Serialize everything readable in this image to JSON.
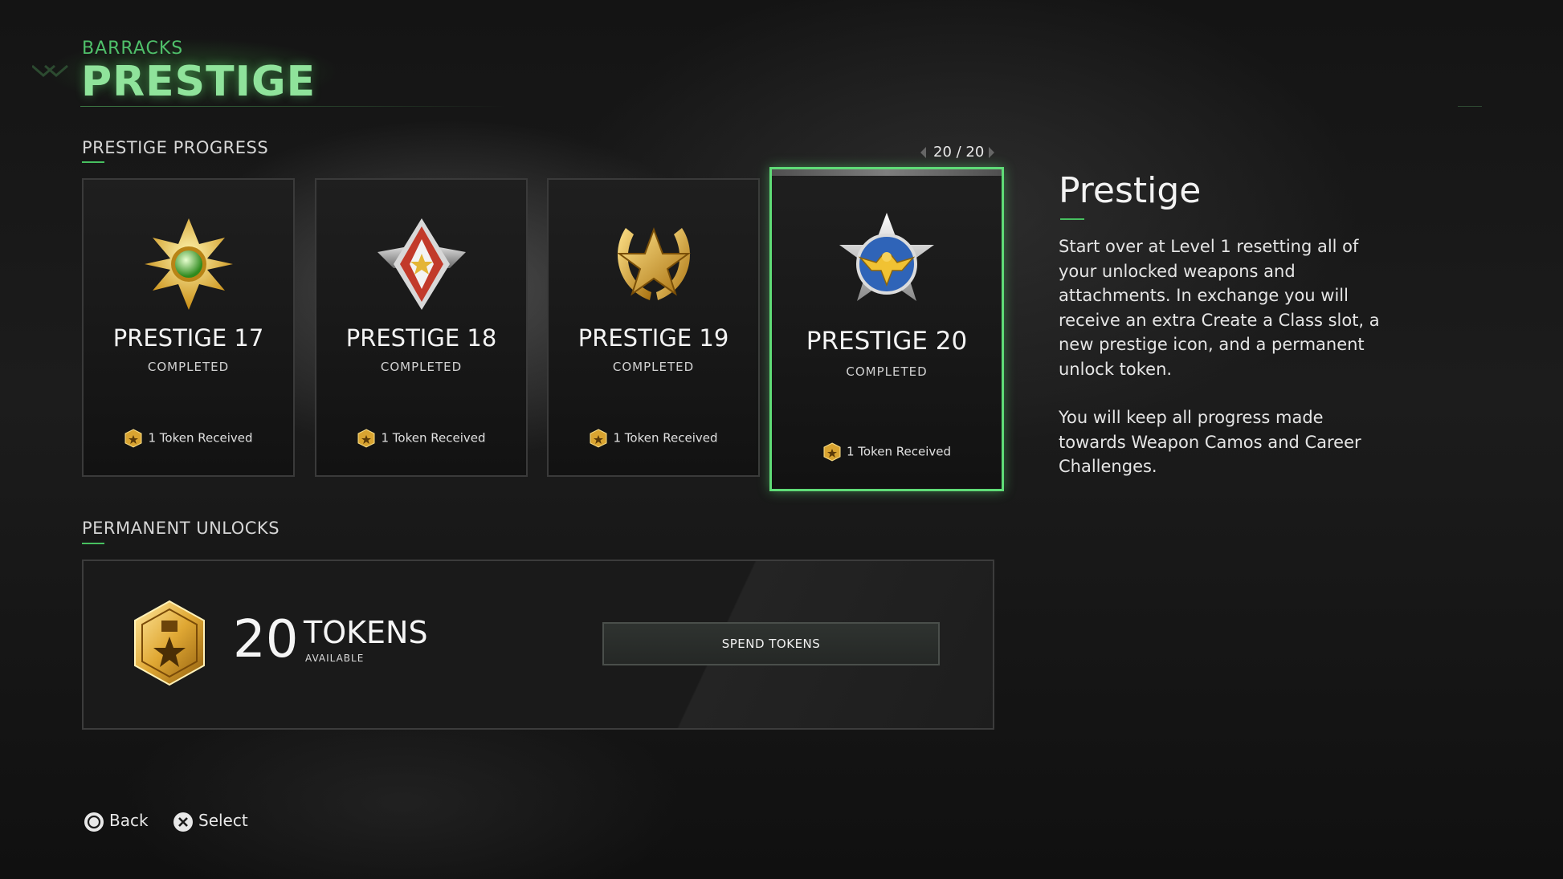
{
  "header": {
    "breadcrumb": "BARRACKS",
    "title": "PRESTIGE"
  },
  "progress_section": {
    "label": "PRESTIGE PROGRESS",
    "pager": "20 / 20"
  },
  "cards": [
    {
      "name": "PRESTIGE 17",
      "status": "COMPLETED",
      "reward": "1 Token Received",
      "emblem": "prestige-17-emblem-icon"
    },
    {
      "name": "PRESTIGE 18",
      "status": "COMPLETED",
      "reward": "1 Token Received",
      "emblem": "prestige-18-emblem-icon"
    },
    {
      "name": "PRESTIGE 19",
      "status": "COMPLETED",
      "reward": "1 Token Received",
      "emblem": "prestige-19-emblem-icon"
    },
    {
      "name": "PRESTIGE 20",
      "status": "COMPLETED",
      "reward": "1 Token Received",
      "emblem": "prestige-20-emblem-icon",
      "selected": true
    }
  ],
  "detail": {
    "title": "Prestige",
    "paragraph1": "Start over at Level 1 resetting all of your unlocked weapons and attachments. In exchange you will receive an extra Create a Class slot, a new prestige icon, and a permanent unlock token.",
    "paragraph2": "You will keep all progress made towards Weapon Camos and Career Challenges."
  },
  "unlocks_section": {
    "label": "PERMANENT UNLOCKS",
    "token_count": "20",
    "token_word": "TOKENS",
    "token_sub": "AVAILABLE",
    "spend_label": "SPEND TOKENS"
  },
  "footer": {
    "back_label": "Back",
    "select_label": "Select"
  },
  "colors": {
    "accent_green": "#47c060",
    "selected_border": "#5fdc77",
    "gold": "#e0b23c"
  }
}
